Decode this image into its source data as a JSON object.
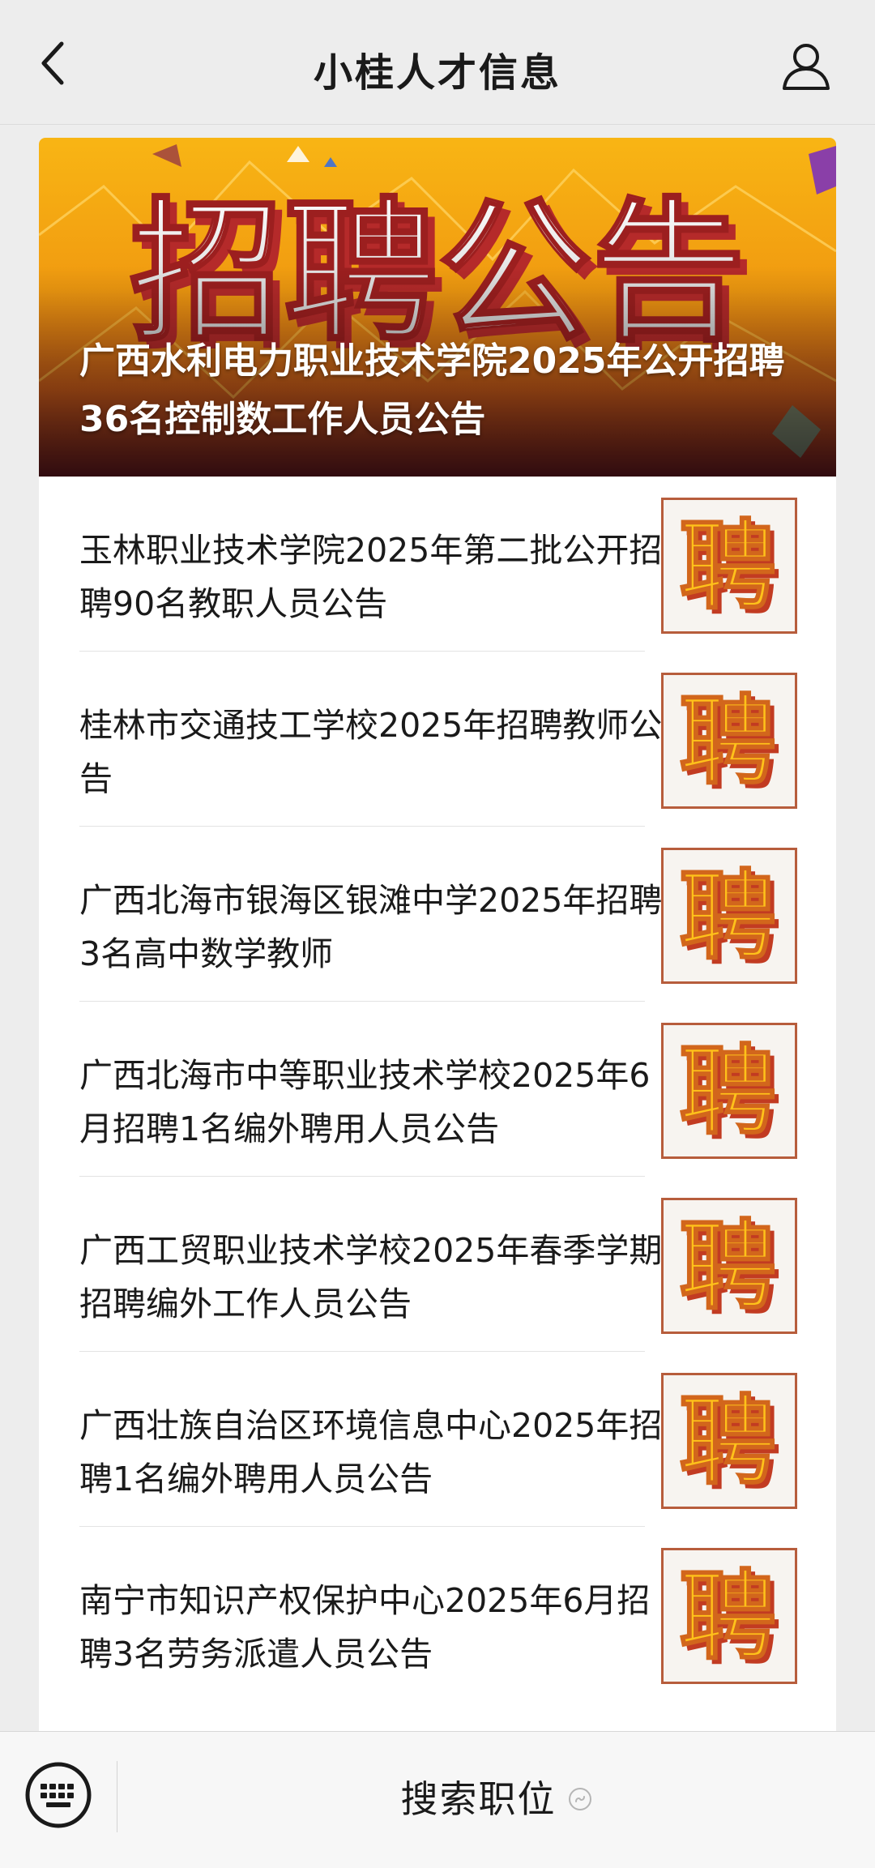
{
  "header": {
    "title": "小桂人才信息",
    "back_icon": "chevron-left-icon",
    "profile_icon": "user-icon"
  },
  "banner": {
    "art_text": "招聘公告",
    "caption": "广西水利电力职业技术学院2025年公开招聘36名控制数工作人员公告",
    "colors": {
      "top": "#f8b514",
      "bottom": "#6d1a22"
    }
  },
  "articles": [
    {
      "title": "玉林职业技术学院2025年第二批公开招聘90名教职人员公告",
      "thumb_text": "聘"
    },
    {
      "title": "桂林市交通技工学校2025年招聘教师公告",
      "thumb_text": "聘"
    },
    {
      "title": "广西北海市银海区银滩中学2025年招聘3名高中数学教师",
      "thumb_text": "聘"
    },
    {
      "title": "广西北海市中等职业技术学校2025年6月招聘1名编外聘用人员公告",
      "thumb_text": "聘"
    },
    {
      "title": "广西工贸职业技术学校2025年春季学期招聘编外工作人员公告",
      "thumb_text": "聘"
    },
    {
      "title": "广西壮族自治区环境信息中心2025年招聘1名编外聘用人员公告",
      "thumb_text": "聘"
    },
    {
      "title": "南宁市知识产权保护中心2025年6月招聘3名劳务派遣人员公告",
      "thumb_text": "聘"
    }
  ],
  "bottom_bar": {
    "keyboard_icon": "keyboard-icon",
    "menu_label": "搜索职位",
    "mini_program_icon": "mini-program-icon"
  }
}
